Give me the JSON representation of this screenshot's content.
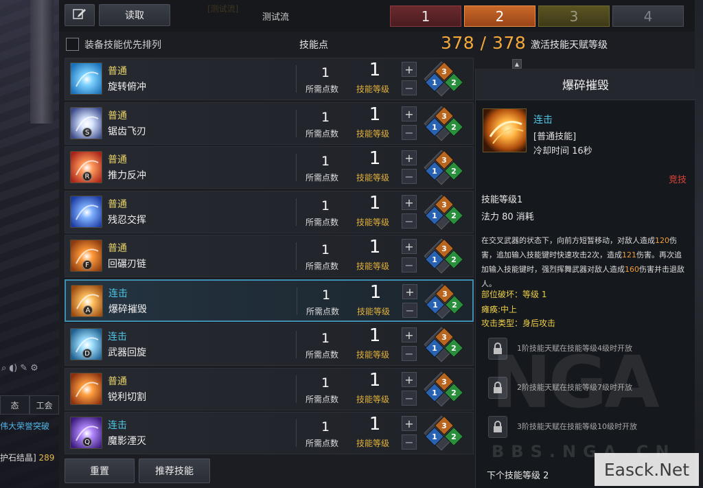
{
  "background": {
    "left_icons": [
      "search-icon",
      "speaker-icon",
      "pen-icon",
      "gear-icon"
    ],
    "left_tabs": [
      "态",
      "工会"
    ],
    "chat_line_1": "伟大荣誉突破",
    "chat_line_2_prefix": "护石结晶]",
    "chat_line_2_number": "289"
  },
  "toolbar": {
    "edit_icon": "pencil-icon",
    "read_label": "读取",
    "build_name": "测试流",
    "build_ghost": "[测试流]",
    "presets": [
      "1",
      "2",
      "3",
      "4"
    ],
    "active_preset": "2"
  },
  "header": {
    "checkbox_label": "装备技能优先排列",
    "skill_points_label": "技能点",
    "skill_points_value": "378 / 378",
    "awaken_label": "激活技能天赋等级"
  },
  "skills": [
    {
      "type": "普通",
      "name": "旋转俯冲",
      "key": "",
      "req": "1",
      "req_label": "所需点数",
      "level": "1",
      "level_label": "技能等级",
      "combo": false,
      "colors": [
        "#1a6fb8",
        "#7fd3ff"
      ]
    },
    {
      "type": "普通",
      "name": "锯齿飞刃",
      "key": "S",
      "req": "1",
      "req_label": "所需点数",
      "level": "1",
      "level_label": "技能等级",
      "combo": false,
      "colors": [
        "#3b4a8a",
        "#d9e6ff"
      ]
    },
    {
      "type": "普通",
      "name": "推力反冲",
      "key": "R",
      "req": "1",
      "req_label": "所需点数",
      "level": "1",
      "level_label": "技能等级",
      "combo": false,
      "colors": [
        "#a8241a",
        "#ff9a5a"
      ]
    },
    {
      "type": "普通",
      "name": "残忍交挥",
      "key": "",
      "req": "1",
      "req_label": "所需点数",
      "level": "1",
      "level_label": "技能等级",
      "combo": false,
      "colors": [
        "#1c3aa0",
        "#7fb0ff"
      ]
    },
    {
      "type": "普通",
      "name": "回碾刃链",
      "key": "F",
      "req": "1",
      "req_label": "所需点数",
      "level": "1",
      "level_label": "技能等级",
      "combo": false,
      "colors": [
        "#8a3a10",
        "#ff9a3a"
      ]
    },
    {
      "type": "连击",
      "name": "爆碎摧毁",
      "key": "A",
      "req": "1",
      "req_label": "所需点数",
      "level": "1",
      "level_label": "技能等级",
      "combo": true,
      "colors": [
        "#9a4a10",
        "#ffc060"
      ]
    },
    {
      "type": "连击",
      "name": "武器回旋",
      "key": "D",
      "req": "1",
      "req_label": "所需点数",
      "level": "1",
      "level_label": "技能等级",
      "combo": true,
      "colors": [
        "#1f5f90",
        "#9fe0ff"
      ]
    },
    {
      "type": "普通",
      "name": "锐利切割",
      "key": "",
      "req": "1",
      "req_label": "所需点数",
      "level": "1",
      "level_label": "技能等级",
      "combo": false,
      "colors": [
        "#8a3010",
        "#ffa040"
      ]
    },
    {
      "type": "连击",
      "name": "魔影湮灭",
      "key": "Q",
      "req": "1",
      "req_label": "所需点数",
      "level": "1",
      "level_label": "技能等级",
      "combo": true,
      "colors": [
        "#3a1a7a",
        "#b48aff"
      ]
    }
  ],
  "selected_skill_index": 5,
  "tripod_levels": [
    "3",
    "1",
    "2"
  ],
  "footer": {
    "reset_label": "重置",
    "recommend_label": "推荐技能"
  },
  "tooltip": {
    "title": "爆碎摧毁",
    "type": "连击",
    "category": "[普通技能]",
    "cooldown": "冷却时间 16秒",
    "counter": "竞技",
    "level": "技能等级1",
    "mana": "法力 80 消耗",
    "desc_parts": [
      {
        "t": "在交叉武器的状态下，向前方短暂移动，对敌人造成",
        "hl": false
      },
      {
        "t": "120",
        "hl": true
      },
      {
        "t": "伤害，追加输入技能键时快速攻击2次，造成",
        "hl": false
      },
      {
        "t": "121",
        "hl": true
      },
      {
        "t": "伤害。再次追加输入技能键时，强烈挥舞武器对敌人造成",
        "hl": false
      },
      {
        "t": "160",
        "hl": true
      },
      {
        "t": "伤害并击退敌人。",
        "hl": false
      }
    ],
    "part_break": "部位破坏：等级 1",
    "stagger": "瘫痪:中上",
    "attack_type": "攻击类型：身后攻击",
    "tripods": [
      "1阶技能天赋在技能等级4级时开放",
      "2阶技能天赋在技能等级7级时开放",
      "3阶技能天赋在技能等级10级时开放"
    ],
    "next_level": "下个技能等级 2"
  },
  "watermark": {
    "logo": "NGA",
    "url": "BBS.NGA.CN",
    "site": "Easck.Net"
  }
}
